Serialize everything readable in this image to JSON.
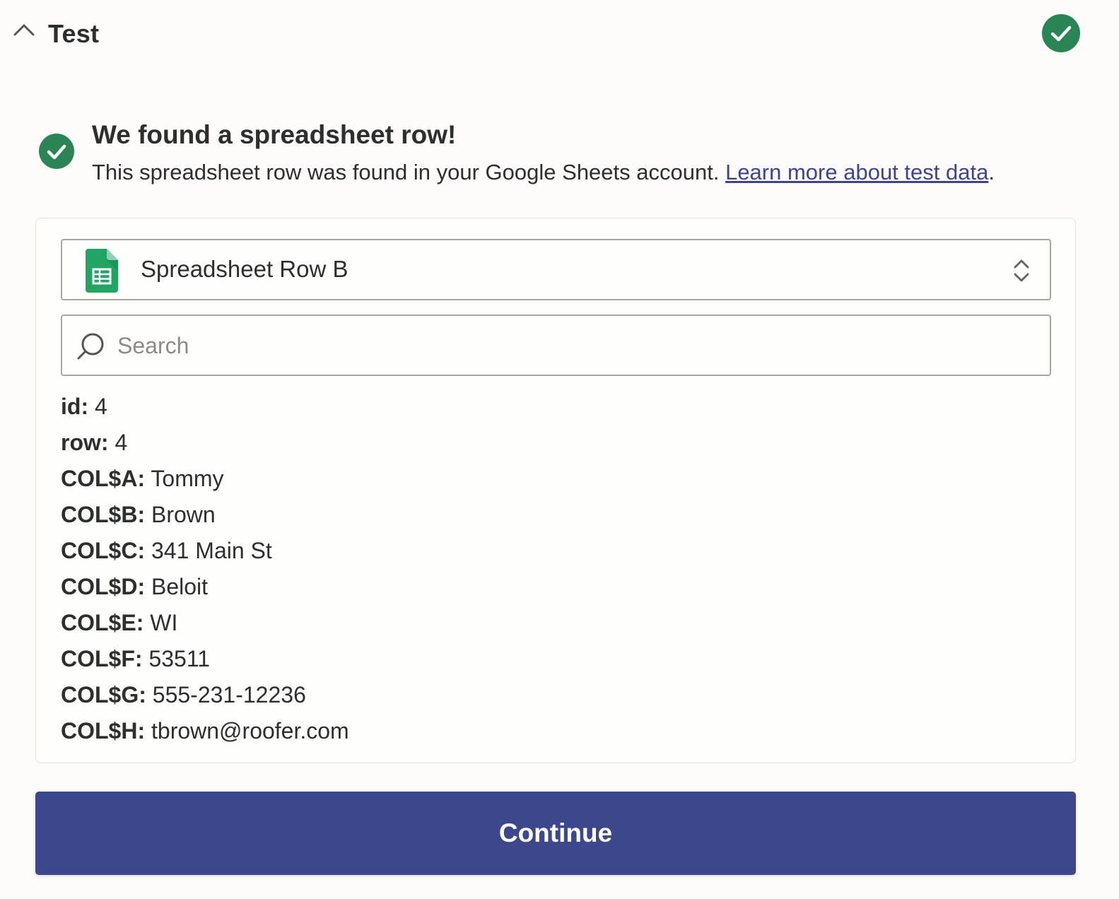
{
  "header": {
    "title": "Test",
    "collapse_icon": "chevron-up-icon",
    "status_icon": "check-circle-icon"
  },
  "success": {
    "title": "We found a spreadsheet row!",
    "description": "This spreadsheet row was found in your Google Sheets account. ",
    "link_text": "Learn more about test data",
    "trailing": "."
  },
  "selector": {
    "value": "Spreadsheet Row B",
    "app_icon": "google-sheets-icon"
  },
  "search": {
    "placeholder": "Search",
    "value": ""
  },
  "fields": [
    {
      "key": "id:",
      "value": "4"
    },
    {
      "key": "row:",
      "value": "4"
    },
    {
      "key": "COL$A:",
      "value": "Tommy"
    },
    {
      "key": "COL$B:",
      "value": "Brown"
    },
    {
      "key": "COL$C:",
      "value": "341 Main St"
    },
    {
      "key": "COL$D:",
      "value": "Beloit"
    },
    {
      "key": "COL$E:",
      "value": "WI"
    },
    {
      "key": "COL$F:",
      "value": "53511"
    },
    {
      "key": "COL$G:",
      "value": "555-231-12236"
    },
    {
      "key": "COL$H:",
      "value": "tbrown@roofer.com"
    }
  ],
  "continue_label": "Continue",
  "colors": {
    "success_green": "#2a8454",
    "primary_button": "#3c478c",
    "link": "#3d4592",
    "sheets_green": "#21a464"
  }
}
